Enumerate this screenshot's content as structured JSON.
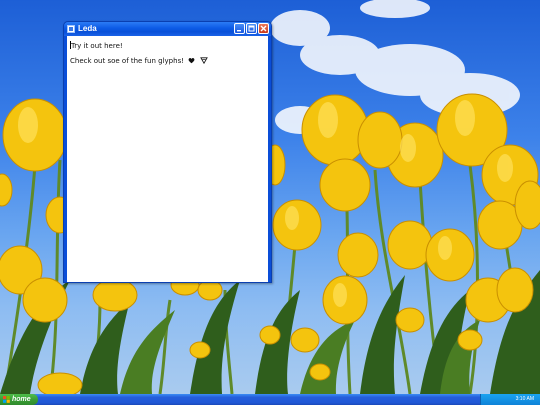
{
  "window": {
    "title": "Leda",
    "buttons": {
      "minimize": "minimize",
      "maximize": "maximize",
      "close": "close"
    }
  },
  "content": {
    "line1": "Try it out here!",
    "line2": "Check out soe of the fun glyphs!"
  },
  "taskbar": {
    "start_label": "home",
    "clock": "3:10 AM"
  },
  "icons": [
    "app-icon",
    "minimize-icon",
    "maximize-icon",
    "close-icon",
    "heart-icon",
    "triangle-glyph-icon",
    "start-logo-icon"
  ],
  "colors": {
    "titlebar": "#0950d8",
    "taskbar": "#245edb",
    "start": "#3a9e36",
    "close": "#c9391b"
  }
}
